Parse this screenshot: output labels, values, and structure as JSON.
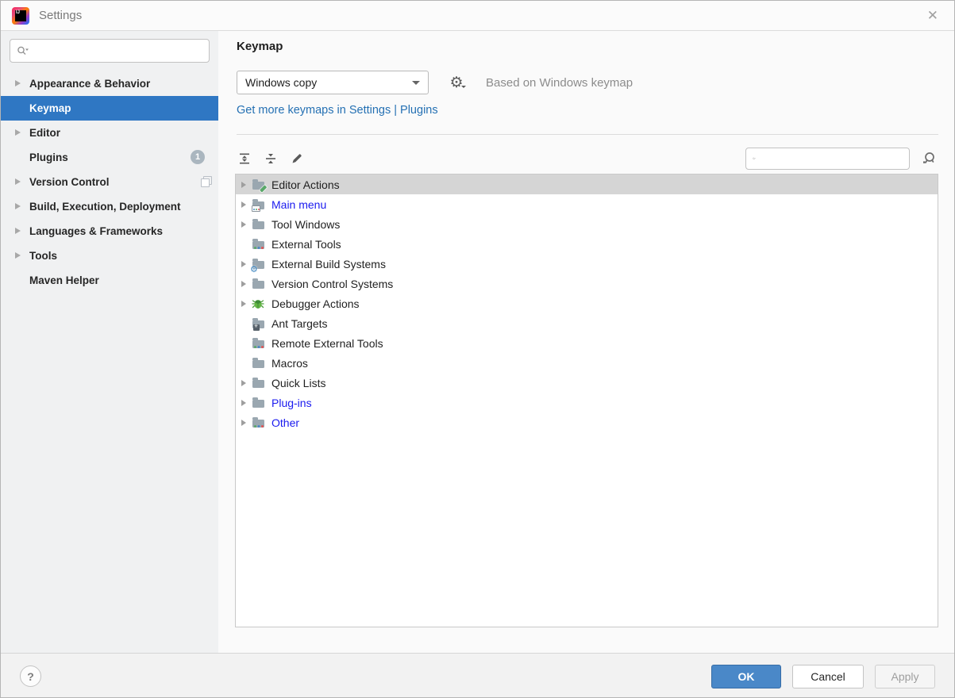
{
  "window": {
    "title": "Settings",
    "close_glyph": "✕"
  },
  "colors": {
    "sidebar_selection_blue": "#2f77c3",
    "link_blue": "#2470b3",
    "modified_item_blue": "#1a1aef",
    "ok_button_blue": "#4a88c8",
    "tree_selection_gray": "#d5d5d5"
  },
  "sidebar": {
    "search": {
      "placeholder": "",
      "value": ""
    },
    "items": [
      {
        "label": "Appearance & Behavior",
        "arrow": true
      },
      {
        "label": "Keymap",
        "selected": true
      },
      {
        "label": "Editor",
        "arrow": true
      },
      {
        "label": "Plugins",
        "badge": "1"
      },
      {
        "label": "Version Control",
        "arrow": true,
        "trailing_icon": "copy-icon"
      },
      {
        "label": "Build, Execution, Deployment",
        "arrow": true
      },
      {
        "label": "Languages & Frameworks",
        "arrow": true
      },
      {
        "label": "Tools",
        "arrow": true
      },
      {
        "label": "Maven Helper"
      }
    ]
  },
  "main": {
    "page_title": "Keymap",
    "keymap_selector": {
      "value": "Windows copy"
    },
    "based_on_text": "Based on Windows keymap",
    "more_keymaps_link": "Get more keymaps in Settings | Plugins",
    "toolbar_icons": [
      "expand-all-icon",
      "collapse-all-icon",
      "edit-pencil-icon"
    ],
    "action_search": {
      "placeholder": "",
      "value": ""
    },
    "tree": {
      "items": [
        {
          "label": "Editor Actions",
          "icon": "folder-edit",
          "arrow": true,
          "selected": true
        },
        {
          "label": "Main menu",
          "icon": "folder-menu",
          "arrow": true,
          "modified": true
        },
        {
          "label": "Tool Windows",
          "icon": "folder",
          "arrow": true
        },
        {
          "label": "External Tools",
          "icon": "folder-dots"
        },
        {
          "label": "External Build Systems",
          "icon": "folder-gear",
          "arrow": true
        },
        {
          "label": "Version Control Systems",
          "icon": "folder",
          "arrow": true
        },
        {
          "label": "Debugger Actions",
          "icon": "bug",
          "arrow": true
        },
        {
          "label": "Ant Targets",
          "icon": "folder-ant"
        },
        {
          "label": "Remote External Tools",
          "icon": "folder-dots"
        },
        {
          "label": "Macros",
          "icon": "folder"
        },
        {
          "label": "Quick Lists",
          "icon": "folder",
          "arrow": true
        },
        {
          "label": "Plug-ins",
          "icon": "folder",
          "arrow": true,
          "modified": true
        },
        {
          "label": "Other",
          "icon": "folder-dots",
          "arrow": true,
          "modified": true
        }
      ]
    }
  },
  "footer": {
    "help_glyph": "?",
    "buttons": {
      "ok": "OK",
      "cancel": "Cancel",
      "apply": "Apply"
    }
  }
}
